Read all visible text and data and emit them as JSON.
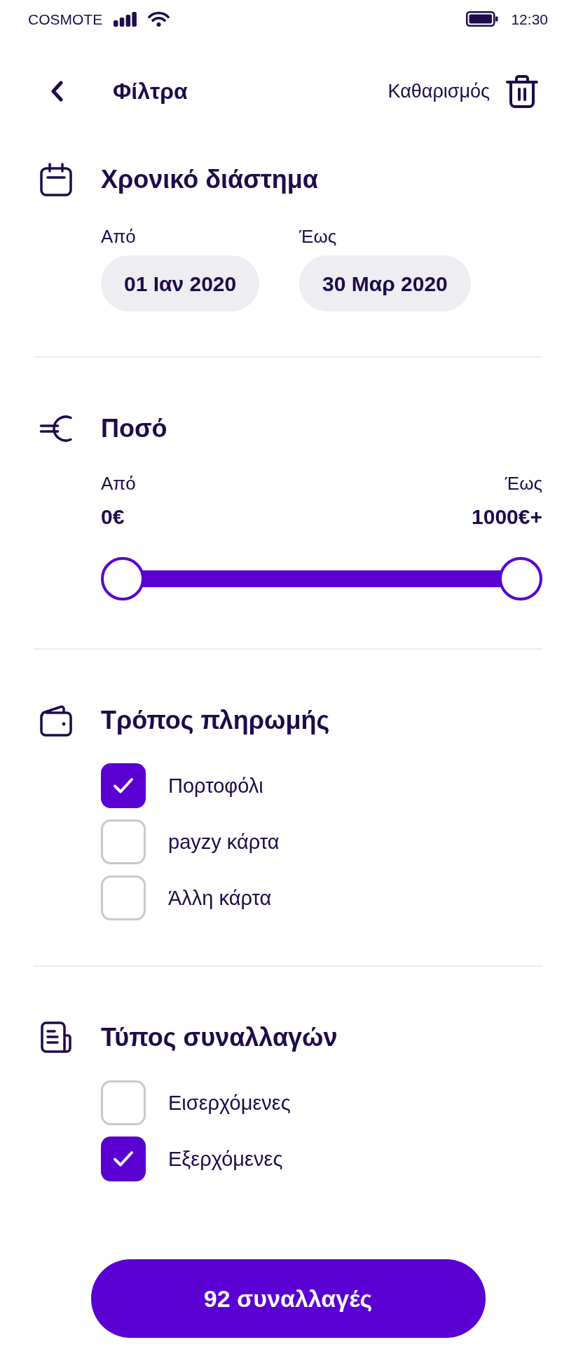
{
  "status_bar": {
    "carrier": "COSMOTE",
    "time": "12:30"
  },
  "header": {
    "title": "Φίλτρα",
    "clear_label": "Καθαρισμός"
  },
  "sections": [
    {
      "kind": "date_range",
      "title": "Χρονικό διάστημα",
      "from": {
        "label": "Από",
        "value": "01 Ιαν 2020"
      },
      "to": {
        "label": "Έως",
        "value": "30 Μαρ 2020"
      }
    },
    {
      "kind": "amount_range",
      "title": "Ποσό",
      "from": {
        "label": "Από",
        "value": "0€"
      },
      "to": {
        "label": "Έως",
        "value": "1000€+"
      },
      "thumbs": [
        {
          "level": 0
        },
        {
          "level": 1
        }
      ]
    },
    {
      "kind": "checklist",
      "title": "Τρόπος πληρωμής",
      "options": [
        {
          "label": "Πορτοφόλι",
          "checked": true
        },
        {
          "label": "payzy κάρτα",
          "checked": false
        },
        {
          "label": "Άλλη κάρτα",
          "checked": false
        }
      ]
    },
    {
      "kind": "checklist",
      "title": "Τύπος συναλλαγών",
      "options": [
        {
          "label": "Εισερχόμενες",
          "checked": false
        },
        {
          "label": "Εξερχόμενες",
          "checked": true
        }
      ]
    }
  ],
  "apply_button": {
    "label": "92 συναλλαγές"
  }
}
